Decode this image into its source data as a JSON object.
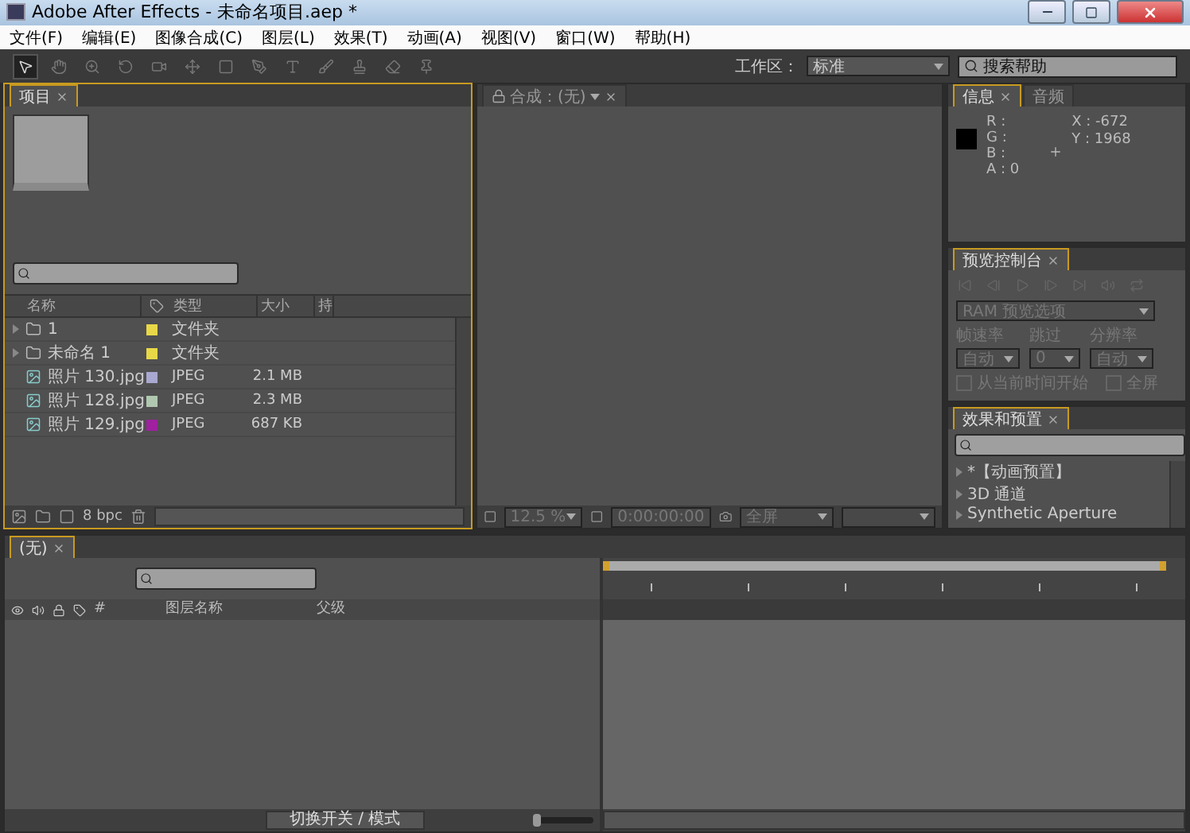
{
  "window": {
    "title": "Adobe After Effects - 未命名项目.aep *"
  },
  "menu": [
    "文件(F)",
    "编辑(E)",
    "图像合成(C)",
    "图层(L)",
    "效果(T)",
    "动画(A)",
    "视图(V)",
    "窗口(W)",
    "帮助(H)"
  ],
  "toolbar": {
    "workspace_label": "工作区：",
    "workspace_value": "标准",
    "help_placeholder": "搜索帮助"
  },
  "project": {
    "tab": "项目",
    "columns": [
      "名称",
      "类型",
      "大小",
      "持"
    ],
    "rows": [
      {
        "kind": "folder",
        "name": "1",
        "type": "文件夹",
        "size": "",
        "color": "#e8d848"
      },
      {
        "kind": "folder",
        "name": "未命名 1",
        "type": "文件夹",
        "size": "",
        "color": "#e8d848"
      },
      {
        "kind": "image",
        "name": "照片 130.jpg",
        "type": "JPEG",
        "size": "2.1 MB",
        "color": "#a8a8d0"
      },
      {
        "kind": "image",
        "name": "照片 128.jpg",
        "type": "JPEG",
        "size": "2.3 MB",
        "color": "#b0c8b0"
      },
      {
        "kind": "image",
        "name": "照片 129.jpg",
        "type": "JPEG",
        "size": "687 KB",
        "color": "#a020a0"
      }
    ],
    "bpc": "8 bpc"
  },
  "composition": {
    "tab": "合成：(无)",
    "zoom": "12.5 %",
    "timecode": "0:00:00:00",
    "resolution": "全屏"
  },
  "info": {
    "tabs": [
      {
        "label": "信息",
        "selected": true
      },
      {
        "label": "音频",
        "selected": false
      }
    ],
    "channels": [
      "R :",
      "G :",
      "B :",
      "A : 0"
    ],
    "x": "X : -672",
    "y": "Y : 1968"
  },
  "preview": {
    "tab": "预览控制台",
    "ram": "RAM 预览选项",
    "fields": [
      {
        "label": "帧速率",
        "value": "自动"
      },
      {
        "label": "跳过",
        "value": "0"
      },
      {
        "label": "分辨率",
        "value": "自动"
      }
    ],
    "options": [
      {
        "label": "从当前时间开始",
        "checked": false
      },
      {
        "label": "全屏",
        "checked": false
      }
    ]
  },
  "effects": {
    "tab": "效果和预置",
    "items": [
      "*【动画预置】",
      "3D 通道",
      "Synthetic Aperture"
    ]
  },
  "timeline": {
    "tab": "(无)",
    "columns": [
      "#",
      "图层名称",
      "父级"
    ],
    "toggle": "切换开关 / 模式",
    "zoom_slider": {
      "level": 0.05
    }
  }
}
